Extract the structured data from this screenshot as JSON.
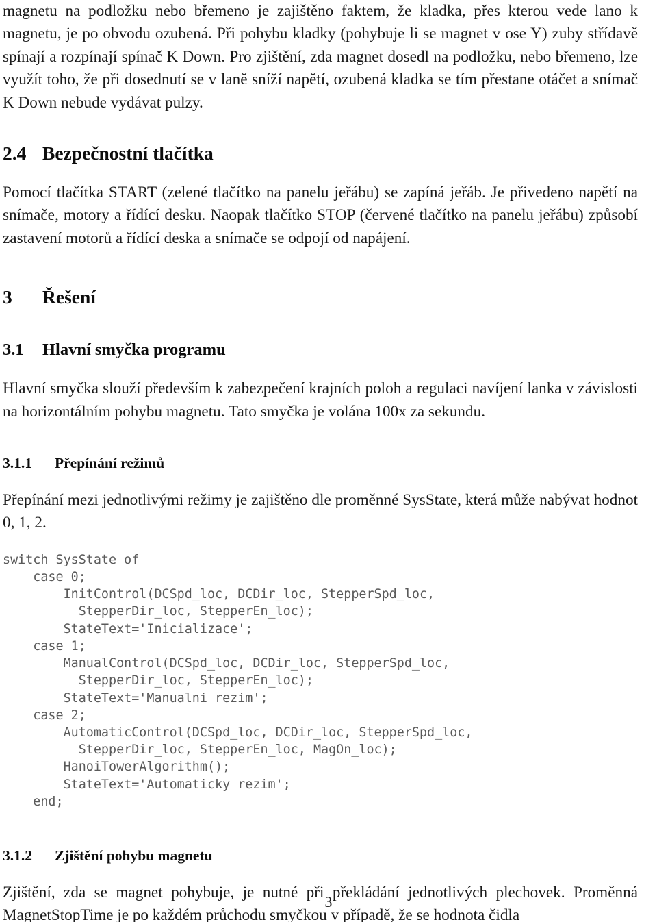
{
  "document": {
    "language": "cs",
    "page_number": "3",
    "text_color": "#1b1b1b",
    "code_color": "#5a5a5a",
    "background": "#ffffff"
  },
  "intro_paragraph": {
    "text": "magnetu na podložku nebo břemeno je zajištěno faktem, že kladka, přes kterou vede lano k magnetu, je po obvodu ozubená. Při pohybu kladky (pohybuje li se magnet v ose Y) zuby střídavě spínají a rozpínají spínač K Down. Pro zjištění, zda magnet dosedl na podložku, nebo břemeno, lze využít toho, že při dosednutí se v laně sníží napětí, ozubená kladka se tím přestane otáčet a snímač K Down nebude vydávat pulzy."
  },
  "section_2_4": {
    "number": "2.4",
    "title": "Bezpečnostní tlačítka",
    "paragraph": "Pomocí tlačítka START (zelené tlačítko na panelu jeřábu) se zapíná jeřáb. Je přivedeno napětí na snímače, motory a řídící desku. Naopak tlačítko STOP (červené tlačítko na panelu jeřábu) způsobí zastavení motorů a řídící deska a snímače se odpojí od napájení."
  },
  "section_3": {
    "number": "3",
    "title": "Řešení"
  },
  "section_3_1": {
    "number": "3.1",
    "title": "Hlavní smyčka programu",
    "paragraph": "Hlavní smyčka slouží především k zabezpečení krajních poloh a regulaci navíjení lanka v závislosti na horizontálním pohybu magnetu. Tato smyčka je volána 100x za sekundu."
  },
  "section_3_1_1": {
    "number": "3.1.1",
    "title": "Přepínání režimů",
    "paragraph": "Přepínání mezi jednotlivými režimy je zajištěno dle proměnné SysState, která může nabývat hodnot 0, 1, 2.",
    "code_listing": "switch SysState of\n    case 0;\n        InitControl(DCSpd_loc, DCDir_loc, StepperSpd_loc,\n          StepperDir_loc, StepperEn_loc);\n        StateText='Inicializace';\n    case 1;\n        ManualControl(DCSpd_loc, DCDir_loc, StepperSpd_loc,\n          StepperDir_loc, StepperEn_loc);\n        StateText='Manualni rezim';\n    case 2;\n        AutomaticControl(DCSpd_loc, DCDir_loc, StepperSpd_loc,\n          StepperDir_loc, StepperEn_loc, MagOn_loc);\n        HanoiTowerAlgorithm();\n        StateText='Automaticky rezim';\n    end;"
  },
  "section_3_1_2": {
    "number": "3.1.2",
    "title": "Zjištění pohybu magnetu",
    "paragraph": "Zjištění, zda se magnet pohybuje, je nutné při překládání jednotlivých plechovek. Proměnná MagnetStopTime je po každém průchodu smyčkou v případě, že se hodnota čidla"
  }
}
